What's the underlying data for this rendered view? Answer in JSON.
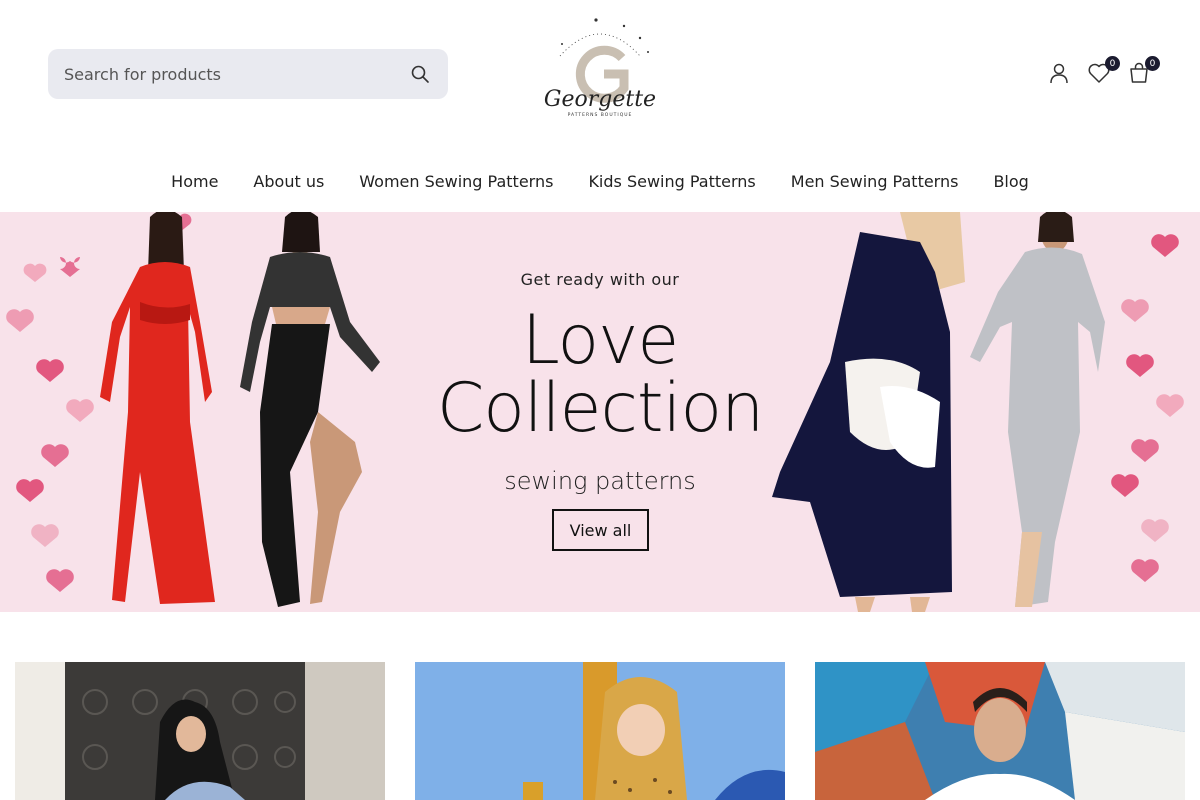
{
  "header": {
    "search": {
      "placeholder": "Search for products"
    },
    "logo": {
      "brand": "Georgette",
      "tagline": "PATTERNS BOUTIQUE"
    },
    "wishlist_count": "0",
    "cart_count": "0"
  },
  "nav": {
    "items": [
      {
        "label": "Home"
      },
      {
        "label": "About us"
      },
      {
        "label": "Women Sewing Patterns"
      },
      {
        "label": "Kids Sewing Patterns"
      },
      {
        "label": "Men Sewing Patterns"
      },
      {
        "label": "Blog"
      }
    ]
  },
  "hero": {
    "kicker": "Get ready with our",
    "headline_line1": "Love",
    "headline_line2": "Collection",
    "subline": "sewing patterns",
    "cta_label": "View all",
    "background_color": "#f8e2ea"
  },
  "colors": {
    "search_bg": "#e9eaf0",
    "badge_bg": "#1b1b2f",
    "text": "#222222"
  }
}
